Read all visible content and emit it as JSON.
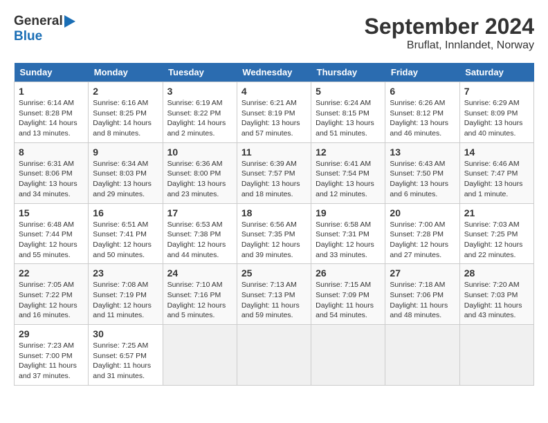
{
  "header": {
    "logo_general": "General",
    "logo_blue": "Blue",
    "title": "September 2024",
    "subtitle": "Bruflat, Innlandet, Norway"
  },
  "days_of_week": [
    "Sunday",
    "Monday",
    "Tuesday",
    "Wednesday",
    "Thursday",
    "Friday",
    "Saturday"
  ],
  "weeks": [
    [
      {
        "day": "1",
        "info": "Sunrise: 6:14 AM\nSunset: 8:28 PM\nDaylight: 14 hours\nand 13 minutes."
      },
      {
        "day": "2",
        "info": "Sunrise: 6:16 AM\nSunset: 8:25 PM\nDaylight: 14 hours\nand 8 minutes."
      },
      {
        "day": "3",
        "info": "Sunrise: 6:19 AM\nSunset: 8:22 PM\nDaylight: 14 hours\nand 2 minutes."
      },
      {
        "day": "4",
        "info": "Sunrise: 6:21 AM\nSunset: 8:19 PM\nDaylight: 13 hours\nand 57 minutes."
      },
      {
        "day": "5",
        "info": "Sunrise: 6:24 AM\nSunset: 8:15 PM\nDaylight: 13 hours\nand 51 minutes."
      },
      {
        "day": "6",
        "info": "Sunrise: 6:26 AM\nSunset: 8:12 PM\nDaylight: 13 hours\nand 46 minutes."
      },
      {
        "day": "7",
        "info": "Sunrise: 6:29 AM\nSunset: 8:09 PM\nDaylight: 13 hours\nand 40 minutes."
      }
    ],
    [
      {
        "day": "8",
        "info": "Sunrise: 6:31 AM\nSunset: 8:06 PM\nDaylight: 13 hours\nand 34 minutes."
      },
      {
        "day": "9",
        "info": "Sunrise: 6:34 AM\nSunset: 8:03 PM\nDaylight: 13 hours\nand 29 minutes."
      },
      {
        "day": "10",
        "info": "Sunrise: 6:36 AM\nSunset: 8:00 PM\nDaylight: 13 hours\nand 23 minutes."
      },
      {
        "day": "11",
        "info": "Sunrise: 6:39 AM\nSunset: 7:57 PM\nDaylight: 13 hours\nand 18 minutes."
      },
      {
        "day": "12",
        "info": "Sunrise: 6:41 AM\nSunset: 7:54 PM\nDaylight: 13 hours\nand 12 minutes."
      },
      {
        "day": "13",
        "info": "Sunrise: 6:43 AM\nSunset: 7:50 PM\nDaylight: 13 hours\nand 6 minutes."
      },
      {
        "day": "14",
        "info": "Sunrise: 6:46 AM\nSunset: 7:47 PM\nDaylight: 13 hours\nand 1 minute."
      }
    ],
    [
      {
        "day": "15",
        "info": "Sunrise: 6:48 AM\nSunset: 7:44 PM\nDaylight: 12 hours\nand 55 minutes."
      },
      {
        "day": "16",
        "info": "Sunrise: 6:51 AM\nSunset: 7:41 PM\nDaylight: 12 hours\nand 50 minutes."
      },
      {
        "day": "17",
        "info": "Sunrise: 6:53 AM\nSunset: 7:38 PM\nDaylight: 12 hours\nand 44 minutes."
      },
      {
        "day": "18",
        "info": "Sunrise: 6:56 AM\nSunset: 7:35 PM\nDaylight: 12 hours\nand 39 minutes."
      },
      {
        "day": "19",
        "info": "Sunrise: 6:58 AM\nSunset: 7:31 PM\nDaylight: 12 hours\nand 33 minutes."
      },
      {
        "day": "20",
        "info": "Sunrise: 7:00 AM\nSunset: 7:28 PM\nDaylight: 12 hours\nand 27 minutes."
      },
      {
        "day": "21",
        "info": "Sunrise: 7:03 AM\nSunset: 7:25 PM\nDaylight: 12 hours\nand 22 minutes."
      }
    ],
    [
      {
        "day": "22",
        "info": "Sunrise: 7:05 AM\nSunset: 7:22 PM\nDaylight: 12 hours\nand 16 minutes."
      },
      {
        "day": "23",
        "info": "Sunrise: 7:08 AM\nSunset: 7:19 PM\nDaylight: 12 hours\nand 11 minutes."
      },
      {
        "day": "24",
        "info": "Sunrise: 7:10 AM\nSunset: 7:16 PM\nDaylight: 12 hours\nand 5 minutes."
      },
      {
        "day": "25",
        "info": "Sunrise: 7:13 AM\nSunset: 7:13 PM\nDaylight: 11 hours\nand 59 minutes."
      },
      {
        "day": "26",
        "info": "Sunrise: 7:15 AM\nSunset: 7:09 PM\nDaylight: 11 hours\nand 54 minutes."
      },
      {
        "day": "27",
        "info": "Sunrise: 7:18 AM\nSunset: 7:06 PM\nDaylight: 11 hours\nand 48 minutes."
      },
      {
        "day": "28",
        "info": "Sunrise: 7:20 AM\nSunset: 7:03 PM\nDaylight: 11 hours\nand 43 minutes."
      }
    ],
    [
      {
        "day": "29",
        "info": "Sunrise: 7:23 AM\nSunset: 7:00 PM\nDaylight: 11 hours\nand 37 minutes."
      },
      {
        "day": "30",
        "info": "Sunrise: 7:25 AM\nSunset: 6:57 PM\nDaylight: 11 hours\nand 31 minutes."
      },
      {
        "day": "",
        "info": ""
      },
      {
        "day": "",
        "info": ""
      },
      {
        "day": "",
        "info": ""
      },
      {
        "day": "",
        "info": ""
      },
      {
        "day": "",
        "info": ""
      }
    ]
  ]
}
